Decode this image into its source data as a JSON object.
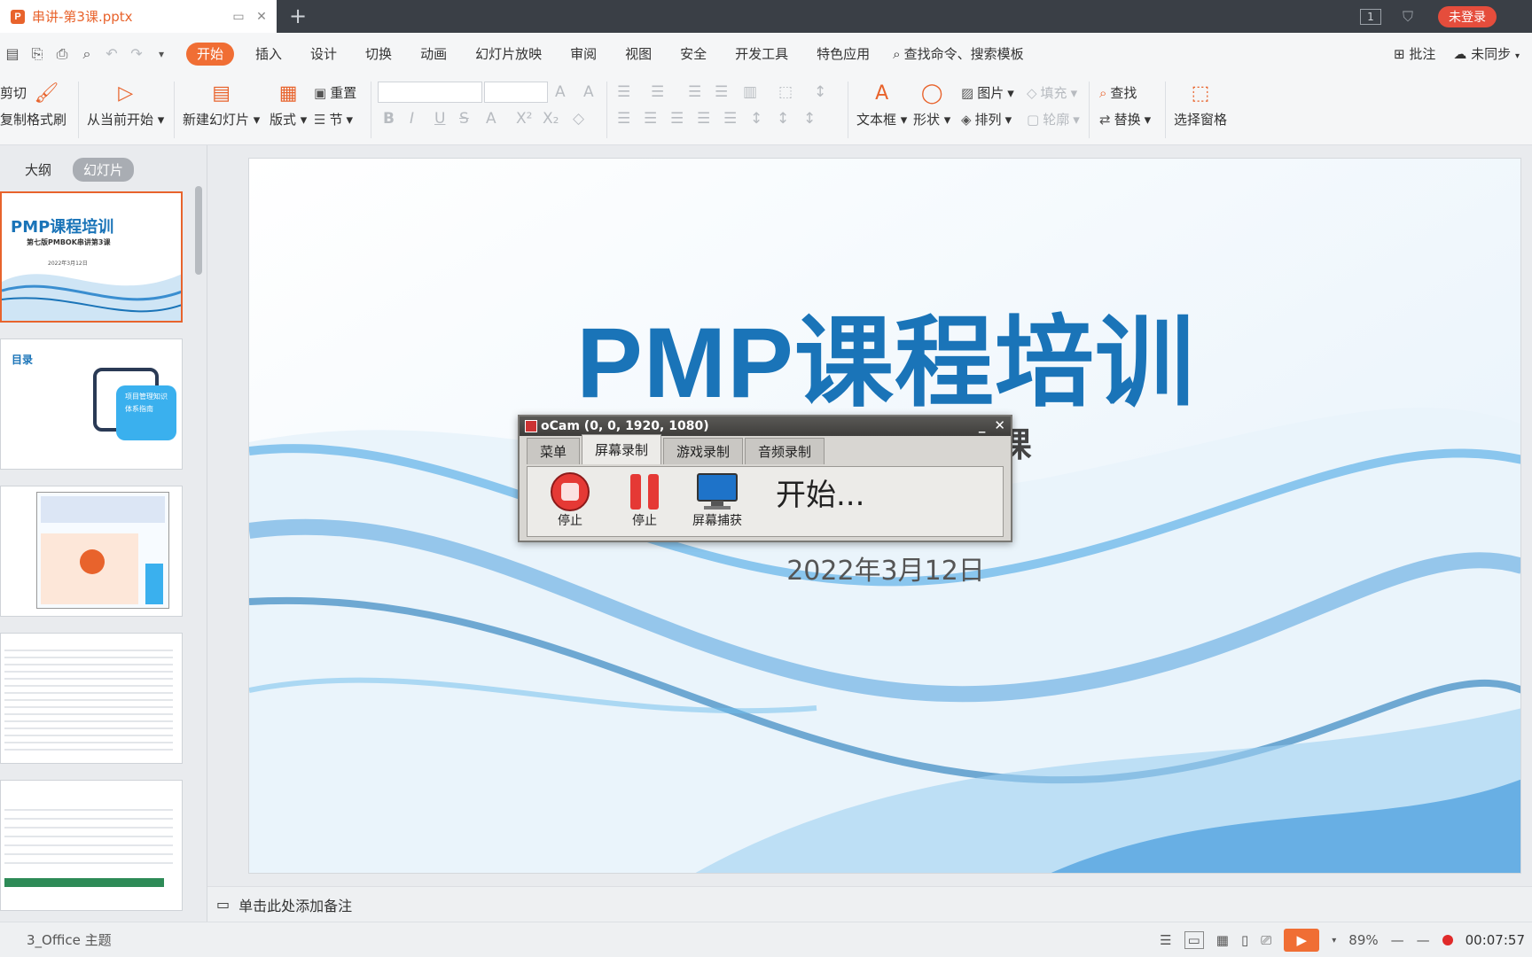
{
  "titlebar": {
    "doc_title": "串讲-第3课.pptx",
    "window_count": "1",
    "login_label": "未登录"
  },
  "menubar": {
    "items": [
      "开始",
      "插入",
      "设计",
      "切换",
      "动画",
      "幻灯片放映",
      "审阅",
      "视图",
      "安全",
      "开发工具",
      "特色应用"
    ],
    "search_label": "查找命令、搜索模板",
    "comment_label": "批注",
    "sync_label": "未同步"
  },
  "ribbon": {
    "cut": "剪切",
    "copy": "复制",
    "format_painter": "格式刷",
    "play_from_current": "从当前开始",
    "new_slide": "新建幻灯片",
    "layout": "版式",
    "reset": "重置",
    "section": "节",
    "textbox": "文本框",
    "shape": "形状",
    "picture": "图片",
    "fill": "填充",
    "arrange": "排列",
    "outline": "轮廓",
    "find": "查找",
    "replace": "替换",
    "selection_pane": "选择窗格"
  },
  "leftpanel": {
    "tab_outline": "大纲",
    "tab_slides": "幻灯片",
    "thumb1_title": "PMP课程培训",
    "thumb1_sub": "第七版PMBOK串讲第3课",
    "thumb1_date": "2022年3月12日",
    "thumb2_title": "目录",
    "thumb2_box": "项目管理知识体系指南"
  },
  "slide": {
    "title": "PMP课程培训",
    "subtitle": "第3课",
    "date": "2022年3月12日"
  },
  "notes": {
    "placeholder": "单击此处添加备注"
  },
  "statusbar": {
    "theme": "3_Office 主题",
    "zoom": "89%",
    "time": "00:07:57"
  },
  "ocam": {
    "title": "oCam (0, 0, 1920, 1080)",
    "tabs": [
      "菜单",
      "屏幕录制",
      "游戏录制",
      "音频录制"
    ],
    "stop_label": "停止",
    "pause_label": "停止",
    "capture_label": "屏幕捕获",
    "status": "开始..."
  }
}
